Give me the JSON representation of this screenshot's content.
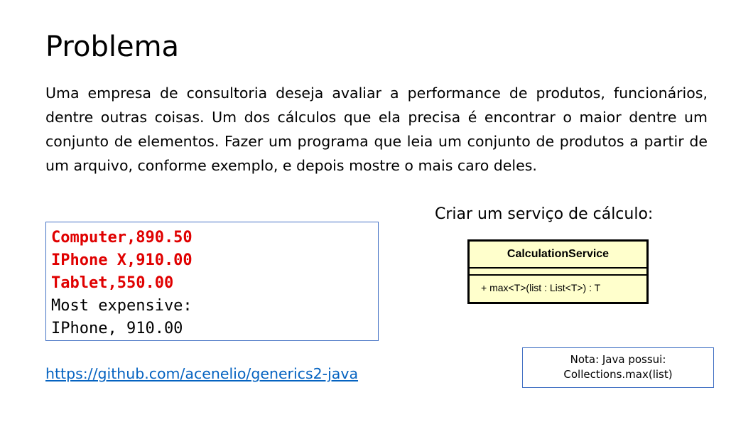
{
  "title": "Problema",
  "paragraph": "Uma empresa de consultoria deseja avaliar a performance de produtos, funcionários, dentre outras coisas. Um dos cálculos que ela precisa é encontrar o maior dentre um conjunto de elementos. Fazer um programa que leia um conjunto de produtos a partir de um arquivo, conforme exemplo, e depois mostre o mais caro deles.",
  "example": {
    "input_lines": [
      "Computer,890.50",
      "IPhone X,910.00",
      "Tablet,550.00"
    ],
    "output_lines": [
      "Most expensive:",
      "IPhone, 910.00"
    ]
  },
  "service": {
    "heading": "Criar um serviço de cálculo:",
    "class_name": "CalculationService",
    "operation": "+ max<T>(list : List<T>) : T"
  },
  "link": "https://github.com/acenelio/generics2-java",
  "note": {
    "line1": "Nota: Java possui:",
    "line2": "Collections.max(list)"
  },
  "colors": {
    "input_text": "#e00000",
    "link": "#0563c1",
    "box_border": "#4472c4",
    "uml_fill": "#ffffcc"
  }
}
